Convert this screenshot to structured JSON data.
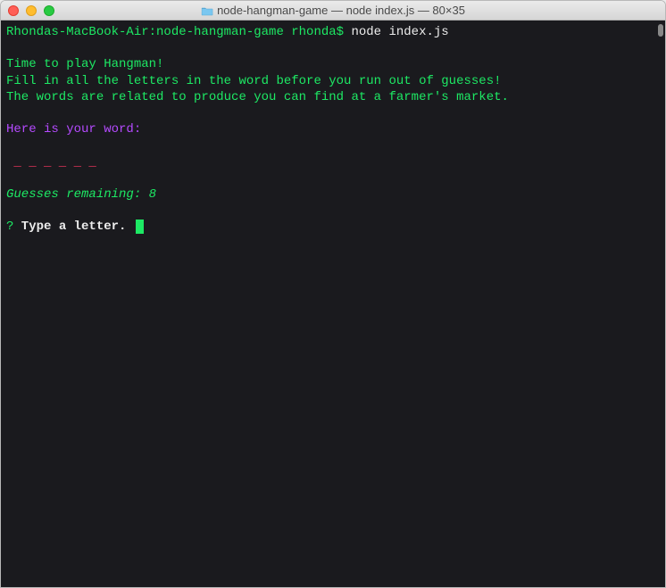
{
  "window": {
    "title": "node-hangman-game — node index.js — 80×35"
  },
  "terminal": {
    "prompt_host": "Rhondas-MacBook-Air:node-hangman-game rhonda$",
    "prompt_command": " node index.js",
    "intro1": "Time to play Hangman!",
    "intro2": "Fill in all the letters in the word before you run out of guesses!",
    "intro3": "The words are related to produce you can find at a farmer's market.",
    "word_label": "Here is your word:",
    "word_blanks": " _ _ _ _ _ _",
    "guesses_label": "Guesses remaining: ",
    "guesses_count": "8",
    "input_q": "?",
    "input_prompt": " Type a letter. "
  }
}
